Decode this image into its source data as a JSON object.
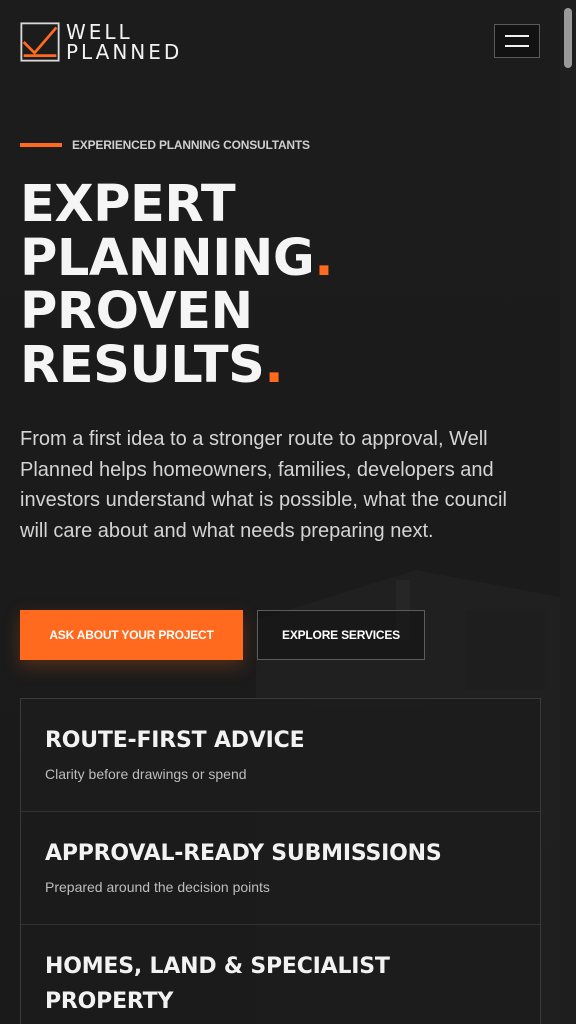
{
  "brand": {
    "line1": "WELL",
    "line2": "PLANNED",
    "accent": "#ff6a1f"
  },
  "header": {
    "menu_icon": "hamburger-icon"
  },
  "hero": {
    "eyebrow": "EXPERIENCED PLANNING CONSULTANTS",
    "headline": {
      "line1": "EXPERT",
      "line2": "PLANNING",
      "line3": "PROVEN",
      "line4": "RESULTS",
      "dot": "."
    },
    "intro": "From a first idea to a stronger route to approval, Well Planned helps homeowners, families, developers and investors understand what is possible, what the council will care about and what needs preparing next.",
    "cta_primary": "ASK ABOUT YOUR PROJECT",
    "cta_secondary": "EXPLORE SERVICES"
  },
  "features": [
    {
      "title": "ROUTE-FIRST ADVICE",
      "subtitle": "Clarity before drawings or spend"
    },
    {
      "title": "APPROVAL-READY SUBMISSIONS",
      "subtitle": "Prepared around the decision points"
    },
    {
      "title": "HOMES, LAND & SPECIALIST PROPERTY",
      "subtitle": ""
    }
  ],
  "colors": {
    "background": "#1b1b1b",
    "text": "#f2f2f2",
    "muted": "#d4d4d4"
  }
}
